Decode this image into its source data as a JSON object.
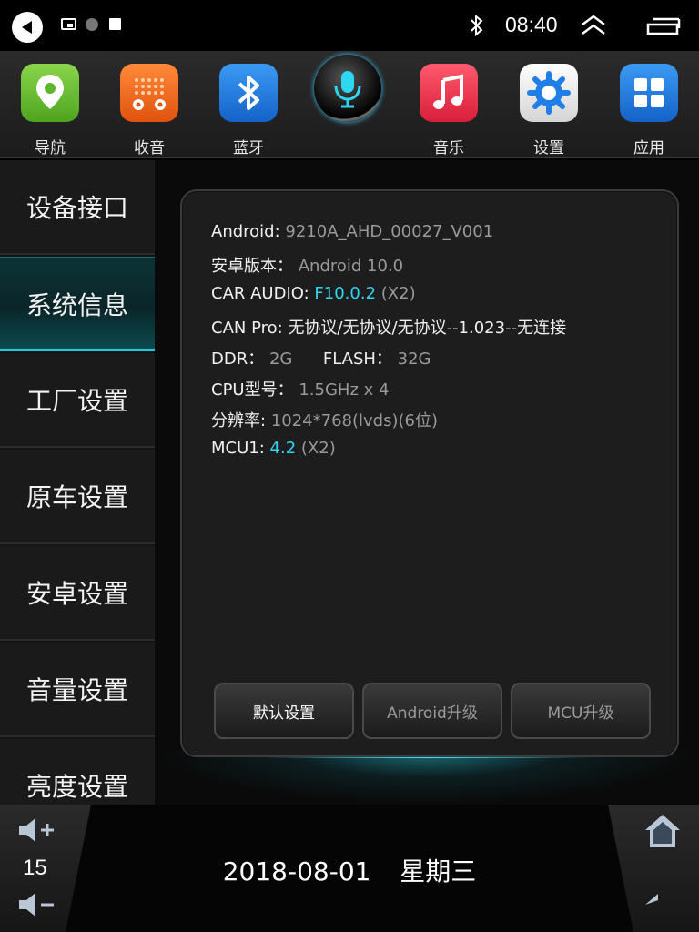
{
  "status_bar": {
    "time": "08:40",
    "icons": [
      "back-icon",
      "cast-icon",
      "record-dot-icon",
      "stop-square-icon",
      "bluetooth-icon",
      "expand-up-icon",
      "recent-apps-icon"
    ]
  },
  "dock": {
    "apps": [
      {
        "label": "导航",
        "icon": "map-pin-icon",
        "color": "#6cc13a"
      },
      {
        "label": "收音",
        "icon": "radio-icon",
        "color": "#f26a1c"
      },
      {
        "label": "蓝牙",
        "icon": "bluetooth-icon",
        "color": "#1f7fe6"
      },
      {
        "label": "",
        "icon": "microphone-icon",
        "color": "#2fd6f0"
      },
      {
        "label": "音乐",
        "icon": "music-note-icon",
        "color": "#e8344f"
      },
      {
        "label": "设置",
        "icon": "gear-icon",
        "color": "#e9e9e9"
      },
      {
        "label": "应用",
        "icon": "apps-grid-icon",
        "color": "#1f7fe6"
      }
    ]
  },
  "sidebar": {
    "items": [
      {
        "label": "设备接口",
        "active": false
      },
      {
        "label": "系统信息",
        "active": true
      },
      {
        "label": "工厂设置",
        "active": false
      },
      {
        "label": "原车设置",
        "active": false
      },
      {
        "label": "安卓设置",
        "active": false
      },
      {
        "label": "音量设置",
        "active": false
      },
      {
        "label": "亮度设置",
        "active": false
      }
    ]
  },
  "system_info": {
    "android_label": "Android:",
    "android_value": "9210A_AHD_00027_V001",
    "version_label": "安卓版本：",
    "version_value": "Android 10.0",
    "car_audio_label": "CAR AUDIO:",
    "car_audio_value": "F10.0.2",
    "car_audio_suffix": "(X2)",
    "can_pro_label": "CAN Pro:",
    "can_pro_value": "无协议/无协议/无协议--1.023--无连接",
    "ddr_label": "DDR：",
    "ddr_value": "2G",
    "flash_label": "FLASH：",
    "flash_value": "32G",
    "cpu_label": "CPU型号：",
    "cpu_value": "1.5GHz x 4",
    "resolution_label": "分辨率:",
    "resolution_value": "1024*768(lvds)(6位)",
    "mcu_label": "MCU1:",
    "mcu_value": "4.2",
    "mcu_suffix": "(X2)"
  },
  "buttons": {
    "default_settings": "默认设置",
    "android_upgrade": "Android升级",
    "mcu_upgrade": "MCU升级"
  },
  "bottom_bar": {
    "volume": "15",
    "date": "2018-08-01",
    "weekday": "星期三"
  },
  "colors": {
    "accent": "#2fd6f0",
    "active_tab_bottom": "#23c9d6"
  }
}
